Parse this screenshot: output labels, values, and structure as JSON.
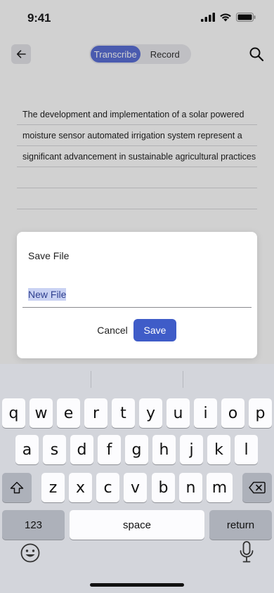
{
  "status": {
    "time": "9:41"
  },
  "header": {
    "tabs": [
      {
        "label": "Transcribe",
        "active": true
      },
      {
        "label": "Record",
        "active": false
      }
    ]
  },
  "document": {
    "lines": [
      "The development and implementation of a solar powered",
      "moisture sensor automated irrigation system represent a",
      "significant advancement in sustainable agricultural practices",
      "",
      ""
    ]
  },
  "dialog": {
    "title": "Save File",
    "input_value": "New File",
    "cancel_label": "Cancel",
    "save_label": "Save"
  },
  "keyboard": {
    "row1": [
      "q",
      "w",
      "e",
      "r",
      "t",
      "y",
      "u",
      "i",
      "o",
      "p"
    ],
    "row2": [
      "a",
      "s",
      "d",
      "f",
      "g",
      "h",
      "j",
      "k",
      "l"
    ],
    "row3": [
      "z",
      "x",
      "c",
      "v",
      "b",
      "n",
      "m"
    ],
    "numbers_label": "123",
    "space_label": "space",
    "return_label": "return"
  },
  "colors": {
    "accent": "#3f5cc8",
    "segment_active": "#5b6fd6",
    "selection": "#c9d2f3"
  }
}
